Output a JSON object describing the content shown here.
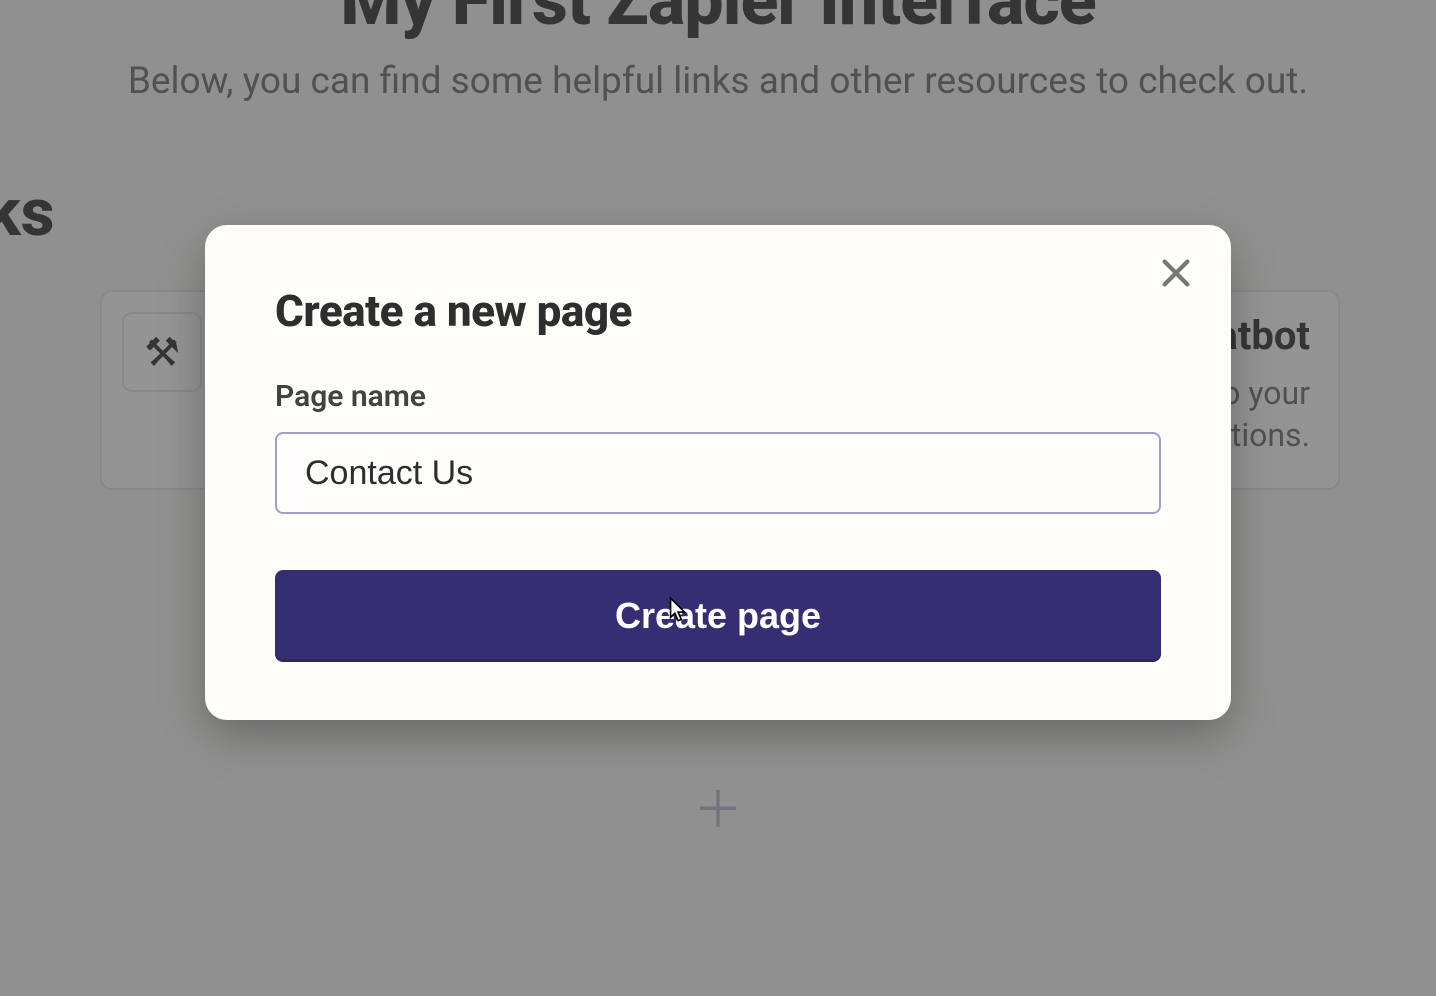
{
  "background": {
    "title": "My First Zapier Interface",
    "subtitle": "Below, you can find some helpful links and other resources to check out.",
    "links_heading": "inks",
    "card_left": {
      "icon_glyph": "⚒"
    },
    "card_right": {
      "title_fragment": "atbot",
      "desc_line1": "o your",
      "desc_line2": "questions."
    },
    "plus_glyph": "＋"
  },
  "modal": {
    "title": "Create a new page",
    "field_label": "Page name",
    "input_value": "Contact Us",
    "submit_label": "Create page"
  }
}
